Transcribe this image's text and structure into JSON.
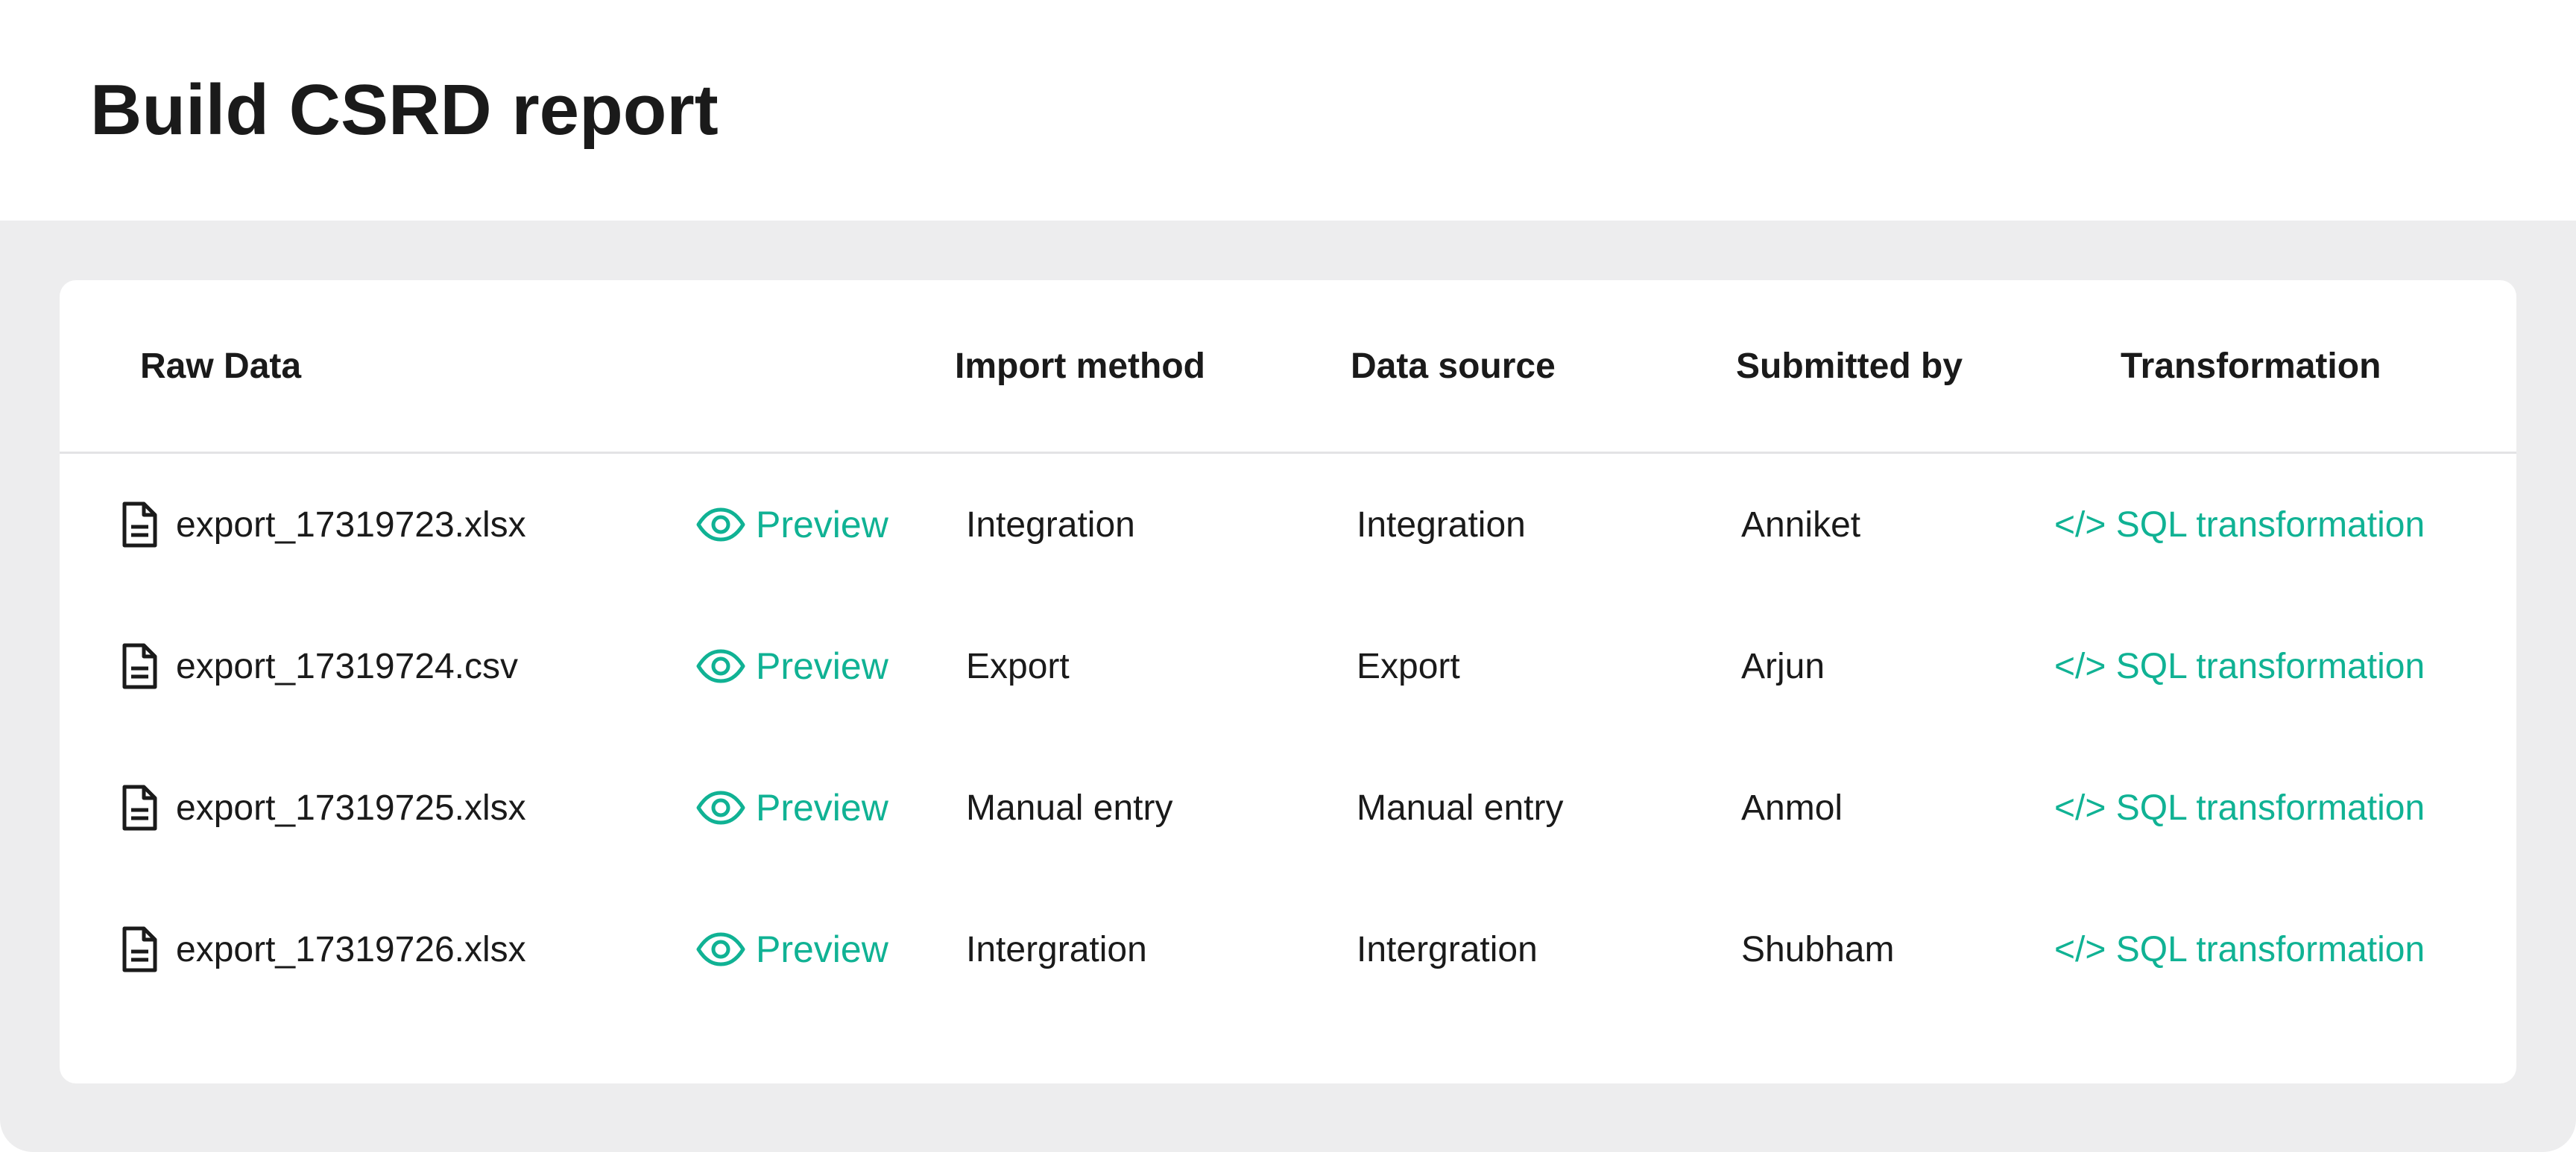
{
  "page": {
    "title": "Build CSRD report"
  },
  "table": {
    "headers": {
      "raw_data": "Raw Data",
      "import_method": "Import method",
      "data_source": "Data source",
      "submitted_by": "Submitted by",
      "transformation": "Transformation"
    },
    "preview_label": "Preview",
    "transformation_label": "</> SQL transformation",
    "rows": [
      {
        "file": "export_17319723.xlsx",
        "import_method": "Integration",
        "data_source": "Integration",
        "submitted_by": "Anniket"
      },
      {
        "file": "export_17319724.csv",
        "import_method": "Export",
        "data_source": "Export",
        "submitted_by": "Arjun"
      },
      {
        "file": "export_17319725.xlsx",
        "import_method": "Manual entry",
        "data_source": "Manual entry",
        "submitted_by": "Anmol"
      },
      {
        "file": "export_17319726.xlsx",
        "import_method": "Intergration",
        "data_source": "Intergration",
        "submitted_by": "Shubham"
      }
    ]
  },
  "icons": {
    "file": "file-document-icon",
    "preview": "eye-icon"
  },
  "colors": {
    "accent": "#10b294",
    "background": "#ededee",
    "card": "#ffffff",
    "text": "#1a1a1a",
    "divider": "#e3e3e5"
  }
}
